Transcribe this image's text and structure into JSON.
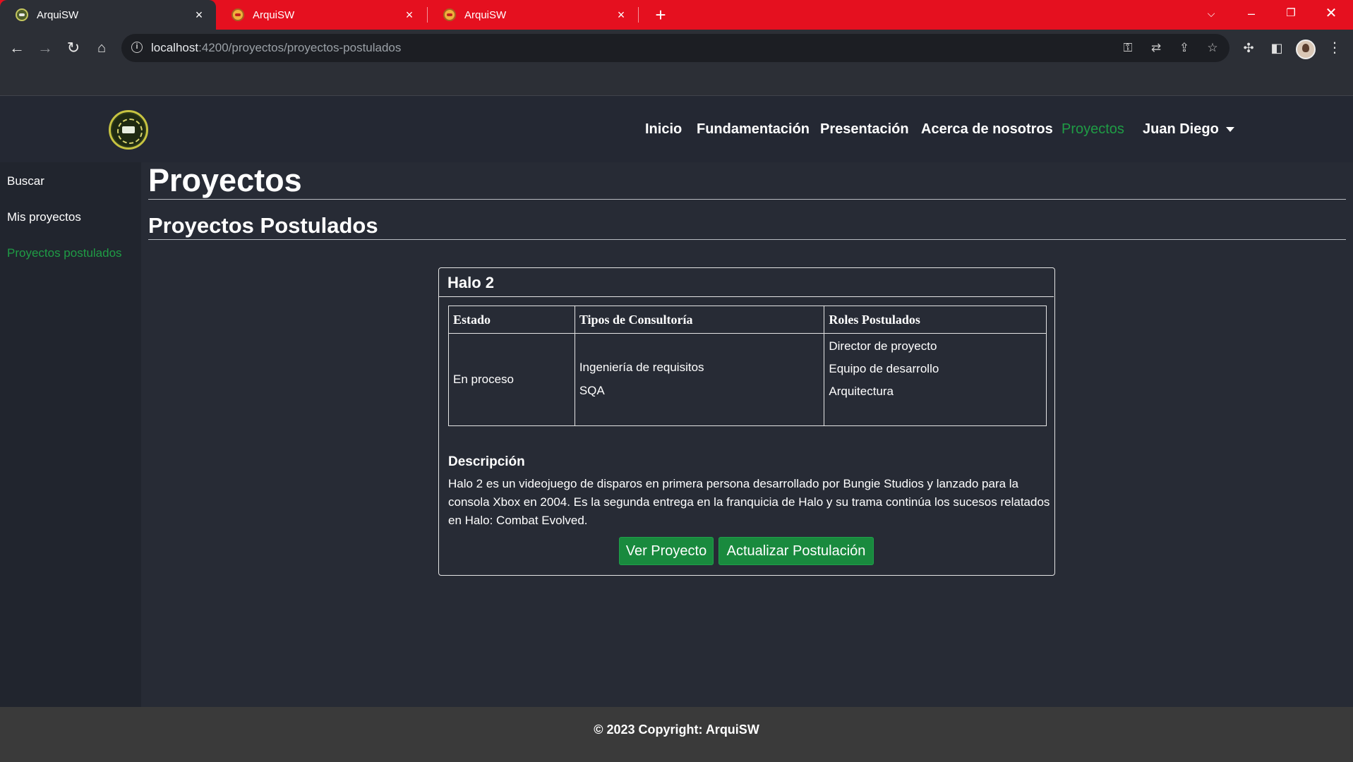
{
  "browser": {
    "tabs": [
      {
        "title": "ArquiSW",
        "active": true
      },
      {
        "title": "ArquiSW",
        "active": false
      },
      {
        "title": "ArquiSW",
        "active": false
      }
    ],
    "url_host": "localhost",
    "url_path": ":4200/proyectos/proyectos-postulados",
    "accent_color": "#e5101f"
  },
  "nav": {
    "items": [
      "Inicio",
      "Fundamentación",
      "Presentación",
      "Acerca de nosotros",
      "Proyectos"
    ],
    "active": "Proyectos",
    "user": "Juan Diego",
    "active_color": "#1f9c45"
  },
  "sidebar": {
    "items": [
      "Buscar",
      "Mis proyectos",
      "Proyectos postulados"
    ],
    "active": "Proyectos postulados"
  },
  "main": {
    "title": "Proyectos",
    "subtitle": "Proyectos Postulados"
  },
  "project": {
    "name": "Halo 2",
    "headers": [
      "Estado",
      "Tipos de Consultoría",
      "Roles Postulados"
    ],
    "estado": "En proceso",
    "tipos": [
      "Ingeniería de requisitos",
      "SQA"
    ],
    "roles": [
      "Director de proyecto",
      "Equipo de desarrollo",
      "Arquitectura"
    ],
    "desc_title": "Descripción",
    "description": "Halo 2 es un videojuego de disparos en primera persona desarrollado por Bungie Studios y lanzado para la consola Xbox en 2004. Es la segunda entrega en la franquicia de Halo y su trama continúa los sucesos relatados en Halo: Combat Evolved.",
    "buttons": [
      "Ver Proyecto",
      "Actualizar Postulación"
    ]
  },
  "footer": {
    "text": "© 2023 Copyright: ArquiSW"
  }
}
